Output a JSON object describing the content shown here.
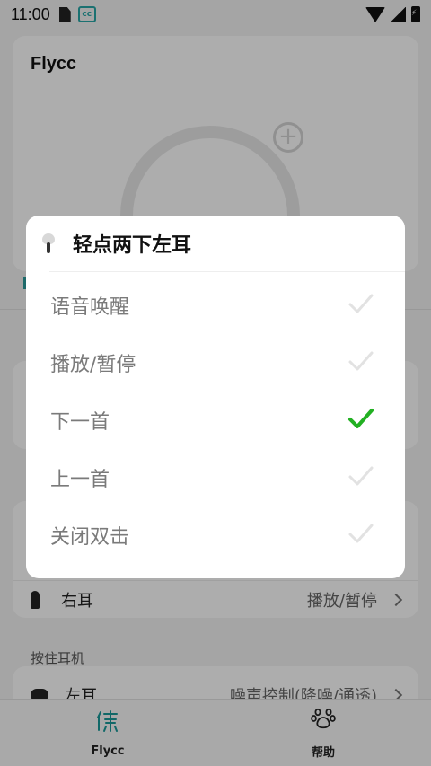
{
  "status_bar": {
    "time": "11:00",
    "app_icon_text": "cc"
  },
  "app": {
    "title": "Flycc",
    "right_ear_row": {
      "label": "右耳",
      "value": "播放/暂停"
    },
    "hold_section_label": "按住耳机",
    "hold_left_row": {
      "label": "左耳",
      "value": "噪声控制(降噪/通透)"
    }
  },
  "bottom_nav": {
    "items": [
      {
        "label": "Flycc",
        "icon": "flycc-logo-icon",
        "active": true
      },
      {
        "label": "帮助",
        "icon": "paw-icon",
        "active": false
      }
    ]
  },
  "dialog": {
    "title": "轻点两下左耳",
    "options": [
      {
        "label": "语音唤醒",
        "selected": false
      },
      {
        "label": "播放/暂停",
        "selected": false
      },
      {
        "label": "下一首",
        "selected": true
      },
      {
        "label": "上一首",
        "selected": false
      },
      {
        "label": "关闭双击",
        "selected": false
      }
    ]
  },
  "colors": {
    "accent": "#1a9a9a",
    "check_selected": "#22b022",
    "check_unselected": "#e2e2e2"
  }
}
